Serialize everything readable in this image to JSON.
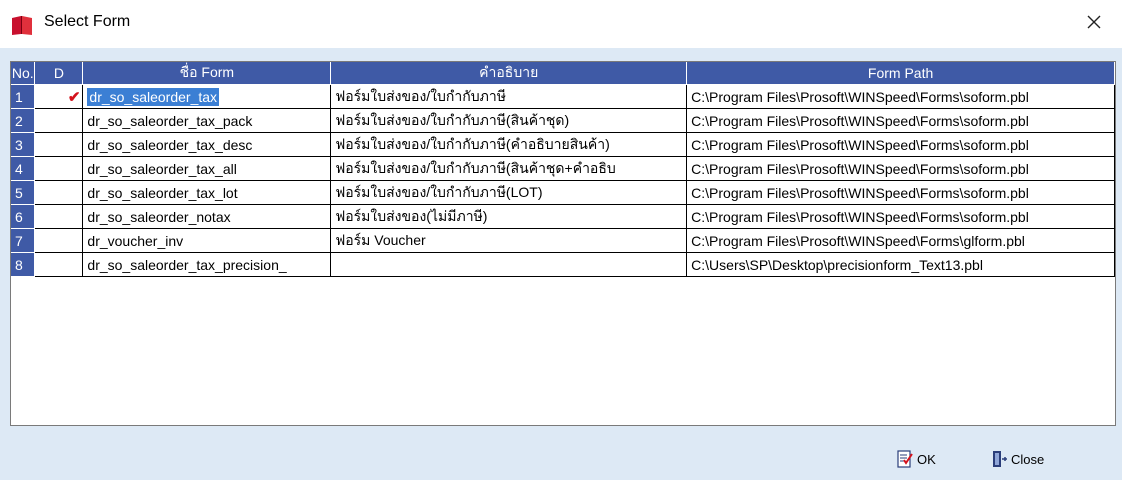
{
  "window": {
    "title": "Select Form"
  },
  "grid": {
    "columns": [
      "No.",
      "D",
      "ชื่อ Form",
      "คำอธิบาย",
      "Form Path"
    ],
    "rows": [
      {
        "no": "1",
        "default": "✔",
        "name": "dr_so_saleorder_tax",
        "desc": "ฟอร์มใบส่งของ/ใบกำกับภาษี",
        "path": "C:\\Program Files\\Prosoft\\WINSpeed\\Forms\\soform.pbl"
      },
      {
        "no": "2",
        "default": "",
        "name": "dr_so_saleorder_tax_pack",
        "desc": "ฟอร์มใบส่งของ/ใบกำกับภาษี(สินค้าชุด)",
        "path": "C:\\Program Files\\Prosoft\\WINSpeed\\Forms\\soform.pbl"
      },
      {
        "no": "3",
        "default": "",
        "name": "dr_so_saleorder_tax_desc",
        "desc": "ฟอร์มใบส่งของ/ใบกำกับภาษี(คำอธิบายสินค้า)",
        "path": "C:\\Program Files\\Prosoft\\WINSpeed\\Forms\\soform.pbl"
      },
      {
        "no": "4",
        "default": "",
        "name": "dr_so_saleorder_tax_all",
        "desc": "ฟอร์มใบส่งของ/ใบกำกับภาษี(สินค้าชุด+คำอธิบ",
        "path": "C:\\Program Files\\Prosoft\\WINSpeed\\Forms\\soform.pbl"
      },
      {
        "no": "5",
        "default": "",
        "name": "dr_so_saleorder_tax_lot",
        "desc": "ฟอร์มใบส่งของ/ใบกำกับภาษี(LOT)",
        "path": "C:\\Program Files\\Prosoft\\WINSpeed\\Forms\\soform.pbl"
      },
      {
        "no": "6",
        "default": "",
        "name": "dr_so_saleorder_notax",
        "desc": "ฟอร์มใบส่งของ(ไม่มีภาษี)",
        "path": "C:\\Program Files\\Prosoft\\WINSpeed\\Forms\\soform.pbl"
      },
      {
        "no": "7",
        "default": "",
        "name": "dr_voucher_inv",
        "desc": "ฟอร์ม Voucher",
        "path": "C:\\Program Files\\Prosoft\\WINSpeed\\Forms\\glform.pbl"
      },
      {
        "no": "8",
        "default": "",
        "name": "dr_so_saleorder_tax_precision_",
        "desc": "",
        "path": "C:\\Users\\SP\\Desktop\\precisionform_Text13.pbl"
      }
    ]
  },
  "buttons": {
    "ok_label": "OK",
    "close_label": "Close"
  },
  "colors": {
    "header_bg": "#3f5aa6",
    "selection": "#3b7fd4",
    "check": "#d4121c",
    "dialog_bg": "#dde9f5"
  }
}
